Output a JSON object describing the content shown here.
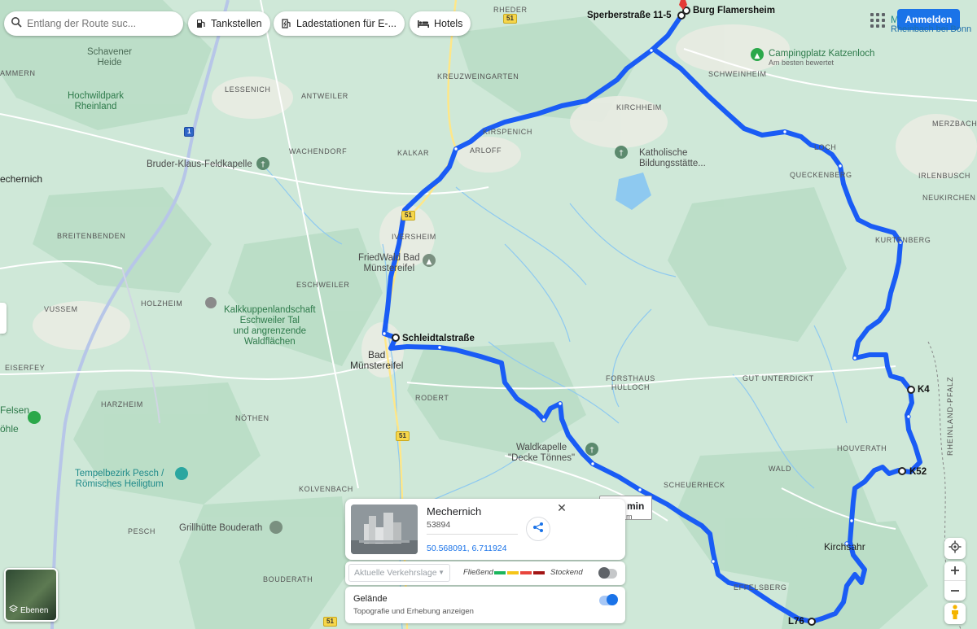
{
  "search": {
    "placeholder": "Entlang der Route suc..."
  },
  "chips": {
    "gas": "Tankstellen",
    "charging": "Ladestationen für E-...",
    "hotels": "Hotels"
  },
  "header": {
    "signin_label": "Anmelden",
    "corner_text_1": "M",
    "corner_text_2": "Rheinbach bei Bonn"
  },
  "route": {
    "start_label": "Sperberstraße 11-5",
    "destination_label": "Burg Flamersheim",
    "waypoint_schleidtal": "Schleidtalstraße",
    "waypoint_k4": "K4",
    "waypoint_k52": "K52",
    "waypoint_l76": "L76",
    "color": "#1a5cf5"
  },
  "roads": {
    "r51_a": "51",
    "r51_b": "51",
    "r51_c": "51",
    "r51_d": "51",
    "a1": "1"
  },
  "places": {
    "rheder": "RHEDER",
    "schavener_heide": "Schavener\nHeide",
    "hochwildpark": "Hochwildpark\nRheinland",
    "lessenich": "LESSENICH",
    "antweiler": "ANTWEILER",
    "kreuzweingarten": "KREUZWEINGARTEN",
    "schweinheim": "SCHWEINHEIM",
    "kirchheim": "KIRCHHEIM",
    "merzbach": "MERZBACH",
    "kirspenich": "KIRSPENICH",
    "arloff": "ARLOFF",
    "wachendorf": "WACHENDORF",
    "kalkar": "KALKAR",
    "bruder_klaus": "Bruder-Klaus-Feldkapelle",
    "katholische": "Katholische\nBildungsstätte...",
    "mechernich": "echernich",
    "loch": "LOCH",
    "queckenberg": "QUECKENBERG",
    "irlenbusch": "IRLENBUSCH",
    "neukirchen": "NEUKIRCHEN",
    "iversheim": "IVERSHEIM",
    "friedwald": "FriedWald Bad\nMünstereifel",
    "kurtenberg": "KURTENBERG",
    "breitenbenden": "BREITENBENDEN",
    "eschweiler": "ESCHWEILER",
    "holzheim": "HOLZHEIM",
    "vussem": "VUSSEM",
    "kalkkuppen": "Kalkkuppenlandschaft\nEschweiler Tal\nund angrenzende\nWaldflächen",
    "bad_muenstereifel": "Bad\nMünstereifel",
    "eiserfey": "EISERFEY",
    "forsthaus": "FORSTHAUS\nHULLOCH",
    "gut_unterdickt": "GUT UNTERDICKT",
    "rodert": "RODERT",
    "harzheim": "HARZHEIM",
    "felsen": "Felsen",
    "ohle": "öhle",
    "noethen": "NÖTHEN",
    "rheinland_pfalz": "RHEINLAND-PFALZ",
    "houverath": "HOUVERATH",
    "waldkapelle": "Waldkapelle\n\"Decke Tönnes\"",
    "wald": "WALD",
    "tempelbezirk": "Tempelbezirk Pesch /\nRömisches Heiligtum",
    "kolvenbach": "KOLVENBACH",
    "scheuerheck": "SCHEUERHECK",
    "grillhuette": "Grillhütte Bouderath",
    "pesch": "PESCH",
    "kirchsahr": "Kirchsahr",
    "bouderath": "BOUDERATH",
    "effelsberg": "EFFELSBERG",
    "ammern": "AMMERN",
    "campingplatz": "Campingplatz Katzenloch",
    "campingplatz_sub": "Am besten bewertet"
  },
  "info_card": {
    "title": "Mechernich",
    "zip": "53894",
    "coordinates": "50.568091, 6.711924",
    "close": "✕"
  },
  "duration_box": {
    "main": "0 min",
    "sub": "m"
  },
  "traffic": {
    "select_value": "Aktuelle Verkehrslage",
    "legend_fast": "Fließend",
    "legend_slow": "Stockend",
    "legend_colors": [
      "#1bb55c",
      "#f5c518",
      "#e8453c",
      "#a31515"
    ],
    "toggle_on": false
  },
  "terrain": {
    "title": "Gelände",
    "subtitle": "Topografie und Erhebung anzeigen",
    "toggle_on": true
  },
  "layers": {
    "label": "Ebenen"
  },
  "icons": {
    "search": "search-icon",
    "gas": "gas-pump-icon",
    "charging": "ev-station-icon",
    "hotels": "bed-icon",
    "apps": "apps-grid-icon",
    "share": "share-icon",
    "locate": "my-location-icon",
    "zoom_in": "plus-icon",
    "zoom_out": "minus-icon",
    "pegman": "pegman-icon"
  }
}
